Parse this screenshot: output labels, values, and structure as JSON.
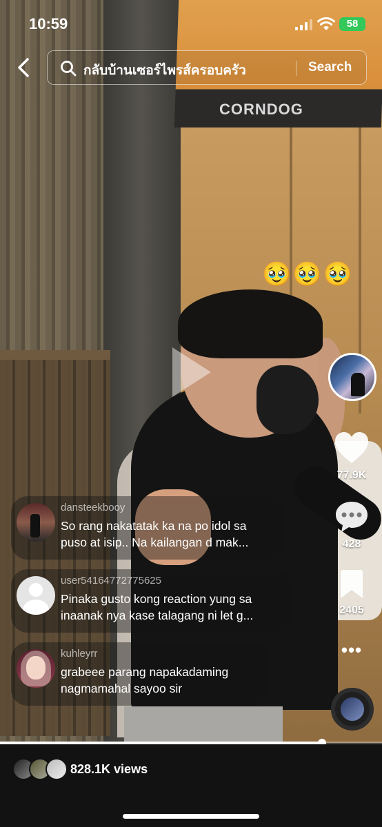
{
  "status_bar": {
    "time": "10:59",
    "battery": "58"
  },
  "search": {
    "query": "กลับบ้านเซอร์ไพรส์ครอบครัว",
    "button_label": "Search"
  },
  "video": {
    "sticker_emojis": "🥹🥹🥹",
    "sign_text": "CORNDOG"
  },
  "side_actions": {
    "like_count": "77.9K",
    "comment_count": "428",
    "bookmark_count": "2405",
    "more_label": "•••"
  },
  "comments": [
    {
      "user": "dansteekbooy",
      "line1": "So rang nakatatak ka na po idol sa",
      "line2": "puso at isip.. Na kailangan d mak..."
    },
    {
      "user": "user54164772775625",
      "line1": "Pinaka gusto kong reaction yung sa",
      "line2": "inaanak nya kase talagang ni let g..."
    },
    {
      "user": "kuhleyrr",
      "line1": "grabeee parang napakadaming",
      "line2": "nagmamahal sayoo sir"
    }
  ],
  "progress": {
    "fraction": 0.843
  },
  "footer": {
    "views": "828.1K views"
  },
  "colors": {
    "battery": "#34c759",
    "bottom_bar": "#121212"
  }
}
